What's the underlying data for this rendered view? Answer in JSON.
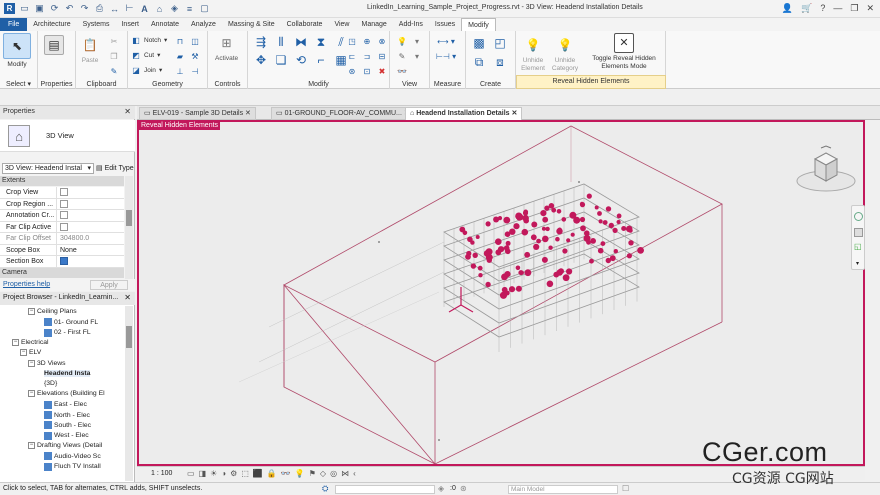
{
  "window": {
    "title": "LinkedIn_Learning_Sample_Project_Progress.rvt - 3D View: Headend Installation Details"
  },
  "menu": {
    "tabs": [
      "File",
      "Architecture",
      "Systems",
      "Insert",
      "Annotate",
      "Analyze",
      "Massing & Site",
      "Collaborate",
      "View",
      "Manage",
      "Add-Ins",
      "Issues",
      "Modify"
    ],
    "active": "Modify"
  },
  "ribbon": {
    "select": {
      "button": "Modify",
      "panel": "Select"
    },
    "properties": {
      "button": "Properties",
      "panel": "Properties"
    },
    "clipboard": {
      "paste": "Paste",
      "panel": "Clipboard"
    },
    "geometry": {
      "notch": "Notch",
      "cut": "Cut",
      "join": "Join",
      "panel": "Geometry"
    },
    "controls": {
      "activate": "Activate",
      "panel": "Controls"
    },
    "modify": {
      "panel": "Modify"
    },
    "view": {
      "panel": "View"
    },
    "measure": {
      "panel": "Measure"
    },
    "create": {
      "panel": "Create"
    },
    "reveal": {
      "unhide_element": "Unhide Element",
      "unhide_category": "Unhide Category",
      "toggle": "Toggle Reveal Hidden Elements Mode",
      "panel": "Reveal Hidden Elements"
    }
  },
  "properties": {
    "header": "Properties",
    "type_name": "3D View",
    "selector": "3D View: Headend Instal",
    "edit_type": "Edit Type",
    "sections": {
      "extents": "Extents",
      "camera": "Camera"
    },
    "rows": [
      {
        "label": "Crop View",
        "value": "",
        "checkbox": false
      },
      {
        "label": "Crop Region ...",
        "value": "",
        "checkbox": false
      },
      {
        "label": "Annotation Cr...",
        "value": "",
        "checkbox": false
      },
      {
        "label": "Far Clip Active",
        "value": "",
        "checkbox": false
      },
      {
        "label": "Far Clip Offset",
        "value": "304800.0",
        "checkbox": null
      },
      {
        "label": "Scope Box",
        "value": "None",
        "checkbox": null
      },
      {
        "label": "Section Box",
        "value": "",
        "checkbox": true
      }
    ],
    "help_link": "Properties help",
    "apply": "Apply"
  },
  "browser": {
    "header": "Project Browser - LinkedIn_Learnin...",
    "nodes": [
      {
        "label": "Ceiling Plans",
        "indent": 3,
        "expand": "−",
        "icon": false,
        "bold": false
      },
      {
        "label": "01- Ground FL",
        "indent": 5,
        "expand": "",
        "icon": true,
        "bold": false
      },
      {
        "label": "02 - First FL",
        "indent": 5,
        "expand": "",
        "icon": true,
        "bold": false
      },
      {
        "label": "Electrical",
        "indent": 1,
        "expand": "−",
        "icon": false,
        "bold": false
      },
      {
        "label": "ELV",
        "indent": 2,
        "expand": "−",
        "icon": false,
        "bold": false
      },
      {
        "label": "3D Views",
        "indent": 3,
        "expand": "−",
        "icon": false,
        "bold": false
      },
      {
        "label": "Headend Insta",
        "indent": 5,
        "expand": "",
        "icon": false,
        "bold": true
      },
      {
        "label": "{3D}",
        "indent": 5,
        "expand": "",
        "icon": false,
        "bold": false
      },
      {
        "label": "Elevations (Building El",
        "indent": 3,
        "expand": "−",
        "icon": false,
        "bold": false
      },
      {
        "label": "East - Elec",
        "indent": 5,
        "expand": "",
        "icon": true,
        "bold": false
      },
      {
        "label": "North - Elec",
        "indent": 5,
        "expand": "",
        "icon": true,
        "bold": false
      },
      {
        "label": "South - Elec",
        "indent": 5,
        "expand": "",
        "icon": true,
        "bold": false
      },
      {
        "label": "West - Elec",
        "indent": 5,
        "expand": "",
        "icon": true,
        "bold": false
      },
      {
        "label": "Drafting Views (Detail",
        "indent": 3,
        "expand": "−",
        "icon": false,
        "bold": false
      },
      {
        "label": "Audio-Video Sc",
        "indent": 5,
        "expand": "",
        "icon": true,
        "bold": false
      },
      {
        "label": "Fluch TV Install",
        "indent": 5,
        "expand": "",
        "icon": true,
        "bold": false
      }
    ]
  },
  "doc_tabs": [
    {
      "label": "ELV-019 - Sample 3D Details",
      "active": false
    },
    {
      "label": "01-GROUND_FLOOR-AV_COMMU...",
      "active": false
    },
    {
      "label": "Headend Installation Details",
      "active": true
    }
  ],
  "viewport": {
    "mode_label": "Reveal Hidden Elements",
    "scale": "1 : 100",
    "accent": "#c2185b"
  },
  "status": {
    "hint": "Click to select, TAB for alternates, CTRL adds, SHIFT unselects.",
    "zero": ":0",
    "model": "Main Model"
  },
  "watermark": {
    "line1": "CGer.com",
    "line2": "CG资源 CG网站"
  }
}
